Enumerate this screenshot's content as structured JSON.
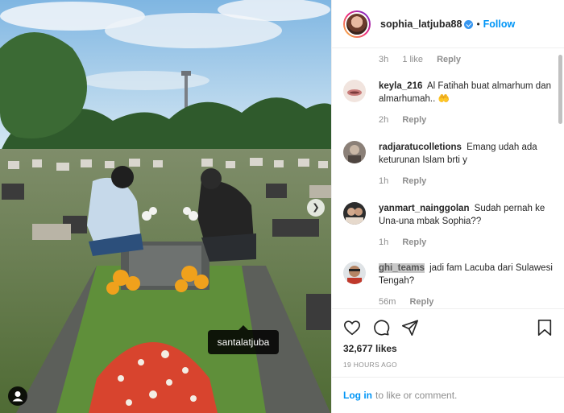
{
  "post": {
    "photo_tag": "santalatjuba",
    "icons": {
      "next": "chevron-right-icon",
      "tag_people": "person-icon"
    }
  },
  "header": {
    "username": "sophia_latjuba88",
    "separator": "•",
    "follow_label": "Follow"
  },
  "first_meta": {
    "time": "3h",
    "likes": "1 like",
    "reply": "Reply"
  },
  "comments": [
    {
      "username": "keyla_216",
      "text": "Al Fatihah buat almarhum dan almarhumah.. 🤲",
      "time": "2h",
      "reply": "Reply",
      "highlight": false
    },
    {
      "username": "radjaratucolletions",
      "text": "Emang udah ada keturunan Islam brti y",
      "time": "1h",
      "reply": "Reply",
      "highlight": false
    },
    {
      "username": "yanmart_nainggolan",
      "text": "Sudah pernah ke Una-una mbak Sophia??",
      "time": "1h",
      "reply": "Reply",
      "highlight": false
    },
    {
      "username": "ghi_teams",
      "text": "jadi fam Lacuba dari Sulawesi Tengah?",
      "time": "56m",
      "reply": "Reply",
      "highlight": true
    }
  ],
  "actions": {
    "likes": "32,677 likes",
    "time_ago": "19 HOURS AGO",
    "login_link": "Log in",
    "login_text": "to like or comment.",
    "icons": [
      "heart-icon",
      "comment-icon",
      "share-icon",
      "bookmark-icon"
    ]
  },
  "colors": {
    "link": "#0095f6",
    "verified": "#3897f0",
    "muted": "#8e8e8e"
  }
}
